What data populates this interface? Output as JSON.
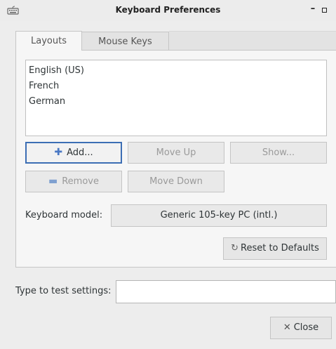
{
  "window": {
    "title": "Keyboard Preferences",
    "minimize_glyph": "–",
    "app_icon": "keyboard-icon"
  },
  "tabs": [
    {
      "label": "Layouts",
      "active": true
    },
    {
      "label": "Mouse Keys",
      "active": false
    }
  ],
  "layouts": {
    "items": [
      "English (US)",
      "French",
      "German"
    ]
  },
  "buttons": {
    "add": {
      "label": "Add...",
      "icon": "plus-icon"
    },
    "move_up": {
      "label": "Move Up"
    },
    "show": {
      "label": "Show..."
    },
    "remove": {
      "label": "Remove",
      "icon": "minus-icon"
    },
    "move_down": {
      "label": "Move Down"
    },
    "reset": {
      "label": "Reset to Defaults",
      "icon": "reset-icon"
    },
    "close": {
      "label": "Close",
      "icon": "close-icon"
    }
  },
  "keyboard_model": {
    "label": "Keyboard model:",
    "value": "Generic 105-key PC (intl.)"
  },
  "test": {
    "label": "Type to test settings:",
    "value": ""
  },
  "colors": {
    "focus_border": "#3c6eb4",
    "plus_icon": "#4a78c4"
  }
}
